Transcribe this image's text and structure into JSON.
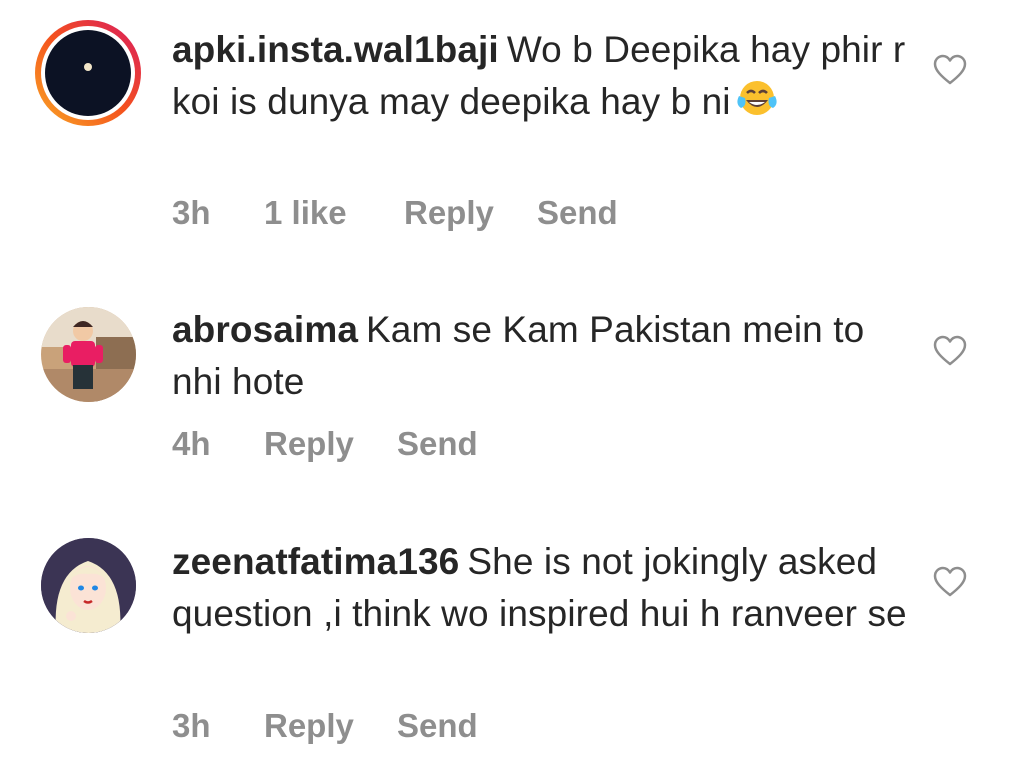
{
  "comments": [
    {
      "username": "apki.insta.wal1baji",
      "text": "Wo b Deepika hay phir r koi is dunya may deepika hay b ni",
      "emoji": "joy-emoji",
      "time": "3h",
      "likes": "1 like",
      "reply_label": "Reply",
      "send_label": "Send",
      "avatar": "dark-avatar-with-story-ring"
    },
    {
      "username": "abrosaima",
      "text": "Kam se Kam Pakistan mein to nhi hote",
      "time": "4h",
      "reply_label": "Reply",
      "send_label": "Send",
      "avatar": "child-photo-avatar"
    },
    {
      "username": "zeenatfatima136",
      "text": "She is not jokingly asked question ,i think wo inspired hui h ranveer se",
      "time": "3h",
      "reply_label": "Reply",
      "send_label": "Send",
      "avatar": "illustrated-girl-avatar"
    }
  ],
  "icons": {
    "like": "heart-outline-icon"
  },
  "colors": {
    "text": "#262626",
    "meta": "#8e8e8e",
    "story_ring_start": "#f9a825",
    "story_ring_end": "#d81b60"
  }
}
